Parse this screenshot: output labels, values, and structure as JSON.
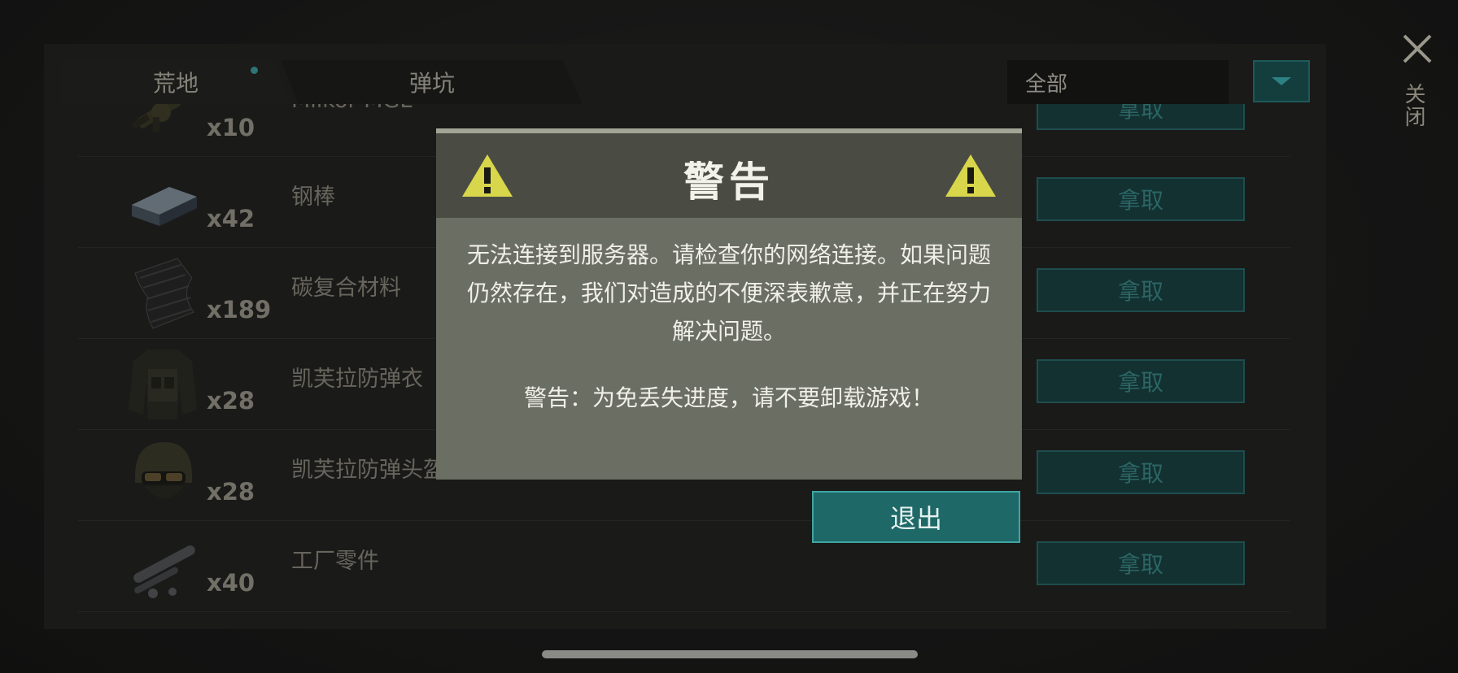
{
  "tabs": [
    {
      "label": "荒地",
      "active": true,
      "has_dot": true
    },
    {
      "label": "弹坑",
      "active": false
    }
  ],
  "filter": {
    "selected": "全部"
  },
  "items": [
    {
      "name": "Milkor MGL",
      "qty": "x10",
      "icon": "grenade-launcher-icon",
      "action": "拿取"
    },
    {
      "name": "钢棒",
      "qty": "x42",
      "icon": "steel-bar-icon",
      "action": "拿取"
    },
    {
      "name": "碳复合材料",
      "qty": "x189",
      "icon": "carbon-composite-icon",
      "action": "拿取"
    },
    {
      "name": "凯芙拉防弹衣",
      "qty": "x28",
      "icon": "kevlar-vest-icon",
      "action": "拿取"
    },
    {
      "name": "凯芙拉防弹头盔",
      "qty": "x28",
      "icon": "kevlar-helmet-icon",
      "action": "拿取"
    },
    {
      "name": "工厂零件",
      "qty": "x40",
      "icon": "factory-parts-icon",
      "action": "拿取"
    }
  ],
  "dialog": {
    "title": "警告",
    "message": "无法连接到服务器。请检查你的网络连接。如果问题仍然存在，我们对造成的不便深表歉意，并正在努力解决问题。",
    "warning": "警告：为免丢失进度，请不要卸载游戏！",
    "exit_label": "退出"
  },
  "close": {
    "label": "关闭"
  },
  "colors": {
    "accent_teal": "#1f6868",
    "warning_yellow": "#d8d64a",
    "dialog_bg": "#6b6e63",
    "dialog_header": "#4a4c44"
  }
}
